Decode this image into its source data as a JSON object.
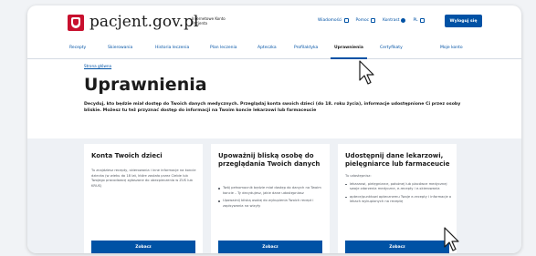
{
  "header": {
    "logo_text": "pacjent.gov.pl",
    "logo_sub": "Internetowe Konto Pacjenta",
    "links": [
      "Wiadomości",
      "Pomoc",
      "Kontrast",
      "PL"
    ],
    "login_label": "Wyloguj się"
  },
  "nav": {
    "items": [
      "Recepty",
      "Skierowania",
      "Historia leczenia",
      "Plan leczenia",
      "Apteczka",
      "Profilaktyka",
      "Uprawnienia",
      "Certyfikaty",
      "Moje konto"
    ],
    "active": "Uprawnienia"
  },
  "breadcrumb": "Strona główna",
  "page_title": "Uprawnienia",
  "page_desc": "Decyduj, kto będzie miał dostęp do Twoich danych medycznych. Przeglądaj konta swoich dzieci (do 18. roku życia), informacje udostępnione Ci przez osoby bliskie. Możesz tu też przyznać dostęp do informacji na Twoim koncie lekarzowi lub farmaceucie",
  "cards": [
    {
      "title": "Konta Twoich dzieci",
      "body": "Tu znajdziesz recepty, skierowania i inne informacje na koncie dziecka (w wieku do 18 lat, które zostało przez Ciebie lub Twojego pracodawcę zgłoszone do ubezpieczenia w ZUS lub KRUS)",
      "bullets": [],
      "button": "Zobacz"
    },
    {
      "title": "Upoważnij bliską osobę do przeglądania Twoich danych",
      "body": "",
      "bullets": [
        "Twój pełnomocnik będzie miał dostęp do danych na Twoim koncie – Ty decydujesz, jakie dane udostępniasz",
        "Upoważnij bliską osobę do wykupienia Twoich recept i zapisywania na wizyty"
      ],
      "button": "Zobacz"
    },
    {
      "title": "Udostępnij dane lekarzowi, pielęgniarce lub farmaceucie",
      "body": "Tu udostępnisz:",
      "bullets": [
        "lekarzowi, pielęgniarce, położnej lub placówce medycznej swoje zdarzenia medyczne, e-recepty i e-skierowania",
        "aptece/punktowi aptecznemu Twoje e-recepty i informacje o lekach wykupionych na receptę"
      ],
      "button": "Zobacz"
    }
  ]
}
